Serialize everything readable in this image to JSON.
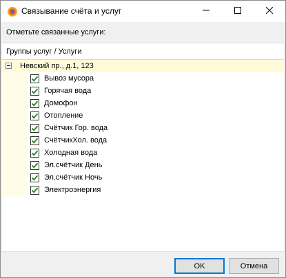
{
  "window": {
    "title": "Связывание счёта и услуг",
    "controls": {
      "minimize": "minimize",
      "maximize": "maximize",
      "close": "close"
    }
  },
  "instruction": "Отметьте связанные услуги:",
  "tree": {
    "header": "Группы услуг / Услуги",
    "root": {
      "label": "Невский пр., д.1, 123",
      "expanded": true
    },
    "items": [
      {
        "label": "Вывоз мусора",
        "checked": true
      },
      {
        "label": "Горячая вода",
        "checked": true
      },
      {
        "label": "Домофон",
        "checked": true
      },
      {
        "label": "Отопление",
        "checked": true
      },
      {
        "label": "Счётчик Гор. вода",
        "checked": true
      },
      {
        "label": "СчётчикХол. вода",
        "checked": true
      },
      {
        "label": "Холодная вода",
        "checked": true
      },
      {
        "label": "Эл.счётчик День",
        "checked": true
      },
      {
        "label": "Эл.счётчик Ночь",
        "checked": true
      },
      {
        "label": "Электроэнергия",
        "checked": true
      }
    ]
  },
  "buttons": {
    "ok": "OK",
    "cancel": "Отмена"
  },
  "colors": {
    "check": "#1a7f1a",
    "row_highlight": "#fffbd9",
    "accent": "#0078d7"
  }
}
